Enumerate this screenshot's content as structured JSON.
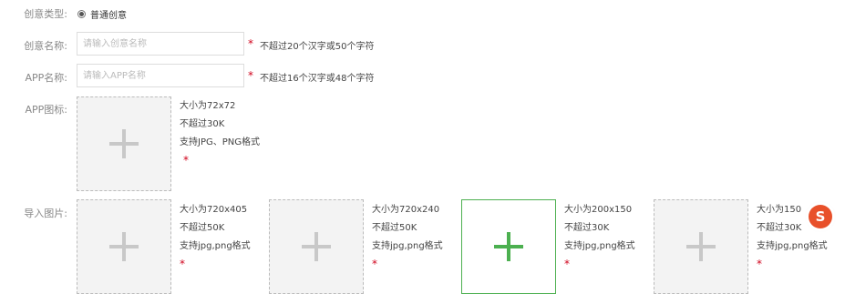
{
  "creative_type": {
    "label": "创意类型:",
    "option": "普通创意"
  },
  "creative_name": {
    "label": "创意名称:",
    "placeholder": "请输入创意名称",
    "required": "*",
    "hint": "不超过20个汉字或50个字符"
  },
  "app_name": {
    "label": "APP名称:",
    "placeholder": "请输入APP名称",
    "required": "*",
    "hint": "不超过16个汉字或48个字符"
  },
  "app_icon": {
    "label": "APP图标:",
    "specs": [
      "大小为72x72",
      "不超过30K",
      "支持JPG、PNG格式"
    ],
    "required": "*"
  },
  "import_images": {
    "label": "导入图片:",
    "slots": [
      {
        "specs": [
          "大小为720x405",
          "不超过50K",
          "支持jpg,png格式"
        ],
        "required": "*"
      },
      {
        "specs": [
          "大小为720x240",
          "不超过50K",
          "支持jpg,png格式"
        ],
        "required": "*"
      },
      {
        "specs": [
          "大小为200x150",
          "不超过30K",
          "支持jpg,png格式"
        ],
        "required": "*"
      },
      {
        "specs": [
          "大小为150",
          "不超过30K",
          "支持jpg,png格式"
        ],
        "required": "*"
      }
    ]
  },
  "ime_badge": "S",
  "colors": {
    "accent_green": "#4cb050",
    "required_red": "#d0021b"
  }
}
